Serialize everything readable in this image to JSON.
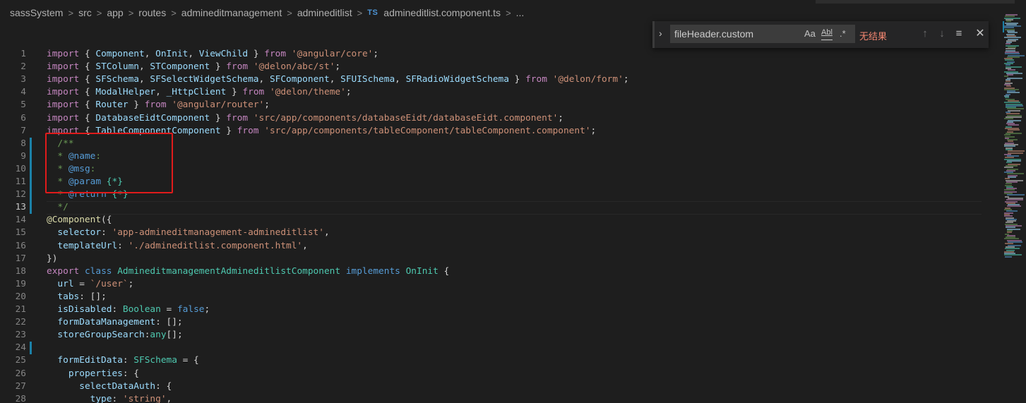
{
  "breadcrumb": {
    "items": [
      "sassSystem",
      "src",
      "app",
      "routes",
      "admineditmanagement",
      "admineditlist"
    ],
    "file_type_badge": "TS",
    "file_name": "admineditlist.component.ts",
    "more": "...",
    "separator": ">"
  },
  "find_widget": {
    "value": "fileHeader.custom",
    "match_case_label": "Aa",
    "whole_word_label": "Abl",
    "regex_label": ".*",
    "result_text": "无结果",
    "prev_icon": "arrow-up-icon",
    "next_icon": "arrow-down-icon",
    "selection_icon": "find-in-selection-icon",
    "close_icon": "close-icon"
  },
  "editor": {
    "active_line": 13,
    "lines": [
      {
        "n": "1",
        "tokens": [
          [
            "kw",
            "import"
          ],
          [
            "pun",
            " { "
          ],
          [
            "var",
            "Component"
          ],
          [
            "pun",
            ", "
          ],
          [
            "var",
            "OnInit"
          ],
          [
            "pun",
            ", "
          ],
          [
            "var",
            "ViewChild"
          ],
          [
            "pun",
            " } "
          ],
          [
            "kw",
            "from"
          ],
          [
            "pun",
            " "
          ],
          [
            "str",
            "'@angular/core'"
          ],
          [
            "pun",
            ";"
          ]
        ]
      },
      {
        "n": "2",
        "tokens": [
          [
            "kw",
            "import"
          ],
          [
            "pun",
            " { "
          ],
          [
            "var",
            "STColumn"
          ],
          [
            "pun",
            ", "
          ],
          [
            "var",
            "STComponent"
          ],
          [
            "pun",
            " } "
          ],
          [
            "kw",
            "from"
          ],
          [
            "pun",
            " "
          ],
          [
            "str",
            "'@delon/abc/st'"
          ],
          [
            "pun",
            ";"
          ]
        ]
      },
      {
        "n": "3",
        "tokens": [
          [
            "kw",
            "import"
          ],
          [
            "pun",
            " { "
          ],
          [
            "var",
            "SFSchema"
          ],
          [
            "pun",
            ", "
          ],
          [
            "var",
            "SFSelectWidgetSchema"
          ],
          [
            "pun",
            ", "
          ],
          [
            "var",
            "SFComponent"
          ],
          [
            "pun",
            ", "
          ],
          [
            "var",
            "SFUISchema"
          ],
          [
            "pun",
            ", "
          ],
          [
            "var",
            "SFRadioWidgetSchema"
          ],
          [
            "pun",
            " } "
          ],
          [
            "kw",
            "from"
          ],
          [
            "pun",
            " "
          ],
          [
            "str",
            "'@delon/form'"
          ],
          [
            "pun",
            ";"
          ]
        ]
      },
      {
        "n": "4",
        "tokens": [
          [
            "kw",
            "import"
          ],
          [
            "pun",
            " { "
          ],
          [
            "var",
            "ModalHelper"
          ],
          [
            "pun",
            ", "
          ],
          [
            "var",
            "_HttpClient"
          ],
          [
            "pun",
            " } "
          ],
          [
            "kw",
            "from"
          ],
          [
            "pun",
            " "
          ],
          [
            "str",
            "'@delon/theme'"
          ],
          [
            "pun",
            ";"
          ]
        ]
      },
      {
        "n": "5",
        "tokens": [
          [
            "kw",
            "import"
          ],
          [
            "pun",
            " { "
          ],
          [
            "var",
            "Router"
          ],
          [
            "pun",
            " } "
          ],
          [
            "kw",
            "from"
          ],
          [
            "pun",
            " "
          ],
          [
            "str",
            "'@angular/router'"
          ],
          [
            "pun",
            ";"
          ]
        ]
      },
      {
        "n": "6",
        "tokens": [
          [
            "kw",
            "import"
          ],
          [
            "pun",
            " { "
          ],
          [
            "var",
            "DatabaseEidtComponent"
          ],
          [
            "pun",
            " } "
          ],
          [
            "kw",
            "from"
          ],
          [
            "pun",
            " "
          ],
          [
            "str",
            "'src/app/components/databaseEidt/databaseEidt.component'"
          ],
          [
            "pun",
            ";"
          ]
        ]
      },
      {
        "n": "7",
        "tokens": [
          [
            "kw",
            "import"
          ],
          [
            "pun",
            " { "
          ],
          [
            "var",
            "TableComponentComponent"
          ],
          [
            "pun",
            " } "
          ],
          [
            "kw",
            "from"
          ],
          [
            "pun",
            " "
          ],
          [
            "str",
            "'src/app/components/tableComponent/tableComponent.component'"
          ],
          [
            "pun",
            ";"
          ]
        ]
      },
      {
        "n": "8",
        "tokens": [
          [
            "pun",
            "  "
          ],
          [
            "com",
            "/**"
          ]
        ]
      },
      {
        "n": "9",
        "tokens": [
          [
            "pun",
            "  "
          ],
          [
            "com",
            "* "
          ],
          [
            "tag",
            "@name"
          ],
          [
            "com",
            ":"
          ]
        ]
      },
      {
        "n": "10",
        "tokens": [
          [
            "pun",
            "  "
          ],
          [
            "com",
            "* "
          ],
          [
            "tag",
            "@msg"
          ],
          [
            "com",
            ":"
          ]
        ]
      },
      {
        "n": "11",
        "tokens": [
          [
            "pun",
            "  "
          ],
          [
            "com",
            "* "
          ],
          [
            "tag",
            "@param"
          ],
          [
            "com",
            " "
          ],
          [
            "type",
            "{*}"
          ]
        ]
      },
      {
        "n": "12",
        "tokens": [
          [
            "pun",
            "  "
          ],
          [
            "com",
            "* "
          ],
          [
            "tag",
            "@return"
          ],
          [
            "com",
            " "
          ],
          [
            "type",
            "{*}"
          ]
        ]
      },
      {
        "n": "13",
        "tokens": [
          [
            "pun",
            "  "
          ],
          [
            "com",
            "*/"
          ]
        ]
      },
      {
        "n": "14",
        "tokens": [
          [
            "dec",
            "@Component"
          ],
          [
            "pun",
            "({"
          ]
        ]
      },
      {
        "n": "15",
        "tokens": [
          [
            "pun",
            "  "
          ],
          [
            "var",
            "selector"
          ],
          [
            "pun",
            ": "
          ],
          [
            "str",
            "'app-admineditmanagement-admineditlist'"
          ],
          [
            "pun",
            ","
          ]
        ]
      },
      {
        "n": "16",
        "tokens": [
          [
            "pun",
            "  "
          ],
          [
            "var",
            "templateUrl"
          ],
          [
            "pun",
            ": "
          ],
          [
            "str",
            "'./admineditlist.component.html'"
          ],
          [
            "pun",
            ","
          ]
        ]
      },
      {
        "n": "17",
        "tokens": [
          [
            "pun",
            "})"
          ]
        ]
      },
      {
        "n": "18",
        "tokens": [
          [
            "kw",
            "export"
          ],
          [
            "pun",
            " "
          ],
          [
            "kw2",
            "class"
          ],
          [
            "pun",
            " "
          ],
          [
            "type",
            "AdmineditmanagementAdmineditlistComponent"
          ],
          [
            "pun",
            " "
          ],
          [
            "kw2",
            "implements"
          ],
          [
            "pun",
            " "
          ],
          [
            "type",
            "OnInit"
          ],
          [
            "pun",
            " {"
          ]
        ]
      },
      {
        "n": "19",
        "tokens": [
          [
            "pun",
            "  "
          ],
          [
            "var",
            "url"
          ],
          [
            "pun",
            " = "
          ],
          [
            "str",
            "`/user`"
          ],
          [
            "pun",
            ";"
          ]
        ]
      },
      {
        "n": "20",
        "tokens": [
          [
            "pun",
            "  "
          ],
          [
            "var",
            "tabs"
          ],
          [
            "pun",
            ": [];"
          ]
        ]
      },
      {
        "n": "21",
        "tokens": [
          [
            "pun",
            "  "
          ],
          [
            "var",
            "isDisabled"
          ],
          [
            "pun",
            ": "
          ],
          [
            "type",
            "Boolean"
          ],
          [
            "pun",
            " = "
          ],
          [
            "kw2",
            "false"
          ],
          [
            "pun",
            ";"
          ]
        ]
      },
      {
        "n": "22",
        "tokens": [
          [
            "pun",
            "  "
          ],
          [
            "var",
            "formDataManagement"
          ],
          [
            "pun",
            ": [];"
          ]
        ]
      },
      {
        "n": "23",
        "tokens": [
          [
            "pun",
            "  "
          ],
          [
            "var",
            "storeGroupSearch"
          ],
          [
            "pun",
            ":"
          ],
          [
            "type",
            "any"
          ],
          [
            "pun",
            "[];"
          ]
        ]
      },
      {
        "n": "24",
        "tokens": []
      },
      {
        "n": "25",
        "tokens": [
          [
            "pun",
            "  "
          ],
          [
            "var",
            "formEditData"
          ],
          [
            "pun",
            ": "
          ],
          [
            "type",
            "SFSchema"
          ],
          [
            "pun",
            " = {"
          ]
        ]
      },
      {
        "n": "26",
        "tokens": [
          [
            "pun",
            "    "
          ],
          [
            "var",
            "properties"
          ],
          [
            "pun",
            ": {"
          ]
        ]
      },
      {
        "n": "27",
        "tokens": [
          [
            "pun",
            "      "
          ],
          [
            "var",
            "selectDataAuth"
          ],
          [
            "pun",
            ": {"
          ]
        ]
      },
      {
        "n": "28",
        "tokens": [
          [
            "pun",
            "        "
          ],
          [
            "var",
            "type"
          ],
          [
            "pun",
            ": "
          ],
          [
            "str",
            "'string'"
          ],
          [
            "pun",
            ","
          ]
        ]
      }
    ]
  },
  "minimap": {
    "accent": "#1b81a8"
  }
}
